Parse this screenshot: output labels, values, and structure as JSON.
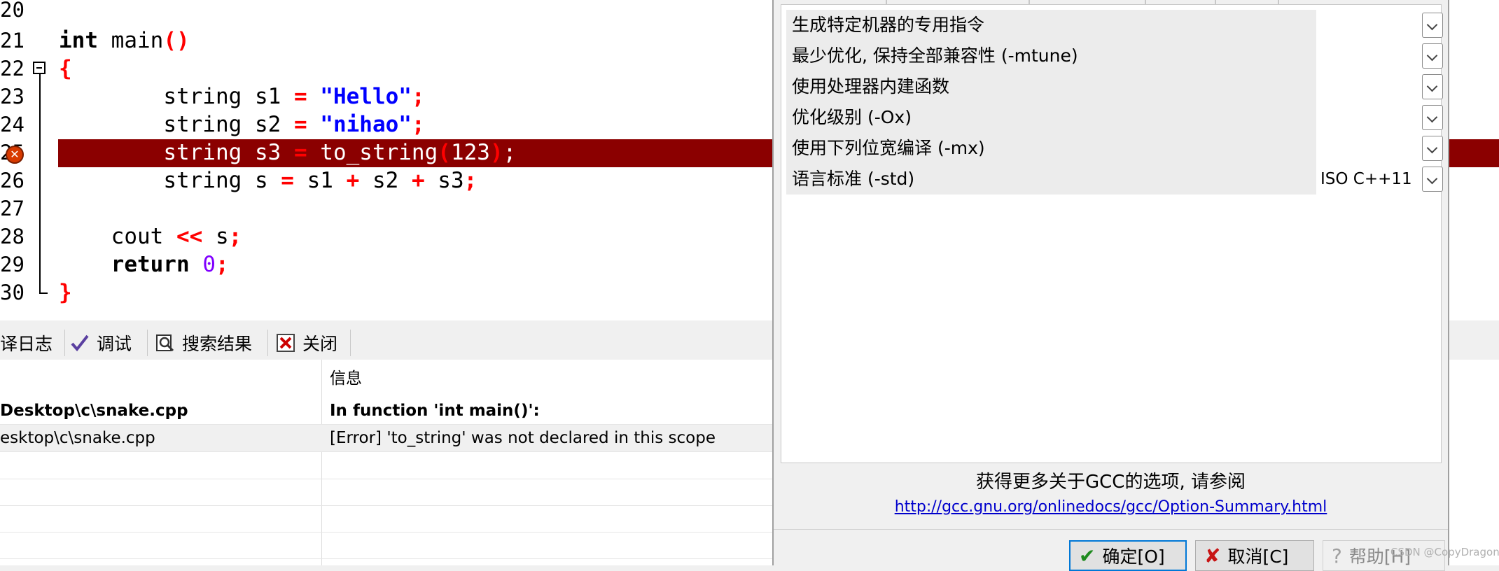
{
  "editor": {
    "line_numbers": [
      "20",
      "21",
      "22",
      "23",
      "24",
      "25",
      "26",
      "27",
      "28",
      "29",
      "30"
    ],
    "lines": {
      "l21": {
        "kw": "int",
        "rest": " main",
        "paren": "()"
      },
      "l22": {
        "brace": "{"
      },
      "l23": {
        "indent": "        ",
        "type": "string",
        "var": " s1 ",
        "eq": "=",
        "sp": " ",
        "str": "\"Hello\"",
        "semi": ";"
      },
      "l24": {
        "indent": "        ",
        "type": "string",
        "var": " s2 ",
        "eq": "=",
        "sp": " ",
        "str": "\"nihao\"",
        "semi": ";"
      },
      "l25": {
        "indent": "        ",
        "type": "string",
        "var": " s3 ",
        "eq": "=",
        "call": " to_string",
        "lp": "(",
        "num": "123",
        "rp": ")",
        "semi": ";"
      },
      "l26": {
        "indent": "        ",
        "type": "string",
        "a": " s ",
        "eq": "=",
        "b": " s1 ",
        "plus1": "+",
        "c": " s2 ",
        "plus2": "+",
        "d": " s3",
        "semi": ";"
      },
      "l28": {
        "indent": "    ",
        "a": "cout ",
        "op": "<<",
        "b": " s",
        "semi": ";"
      },
      "l29": {
        "indent": "    ",
        "kw": "return",
        "sp": " ",
        "num": "0",
        "semi": ";"
      },
      "l30": {
        "brace": "}"
      }
    },
    "highlight_color": "#8b0000"
  },
  "tabs": [
    {
      "label": "译日志",
      "icon": "compile-log-icon"
    },
    {
      "label": "调试",
      "icon": "debug-check-icon"
    },
    {
      "label": "搜索结果",
      "icon": "search-results-icon"
    },
    {
      "label": "关闭",
      "icon": "close-icon"
    }
  ],
  "messages": {
    "header_col2": "信息",
    "rows": [
      {
        "file": "esktop\\c\\snake.cpp",
        "file_prefix": "D",
        "msg": "In function 'int main()':",
        "bold": true
      },
      {
        "file": "esktop\\c\\snake.cpp",
        "msg": "[Error] 'to_string' was not declared in this scope",
        "bold": false
      }
    ]
  },
  "dialog": {
    "options": [
      {
        "label": "生成特定机器的专用指令",
        "value": ""
      },
      {
        "label": "最少优化, 保持全部兼容性 (-mtune)",
        "value": ""
      },
      {
        "label": "使用处理器内建函数",
        "value": ""
      },
      {
        "label": "优化级别 (-Ox)",
        "value": ""
      },
      {
        "label": "使用下列位宽编译 (-mx)",
        "value": ""
      },
      {
        "label": "语言标准 (-std)",
        "value": "ISO C++11"
      }
    ],
    "gcc_text": "获得更多关于GCC的选项, 请参阅",
    "gcc_link": "http://gcc.gnu.org/onlinedocs/gcc/Option-Summary.html",
    "ok_label": "确定[O]",
    "cancel_label": "取消[C]",
    "help_label": "帮助[H]"
  },
  "watermark": "CSDN @CopyDragon"
}
